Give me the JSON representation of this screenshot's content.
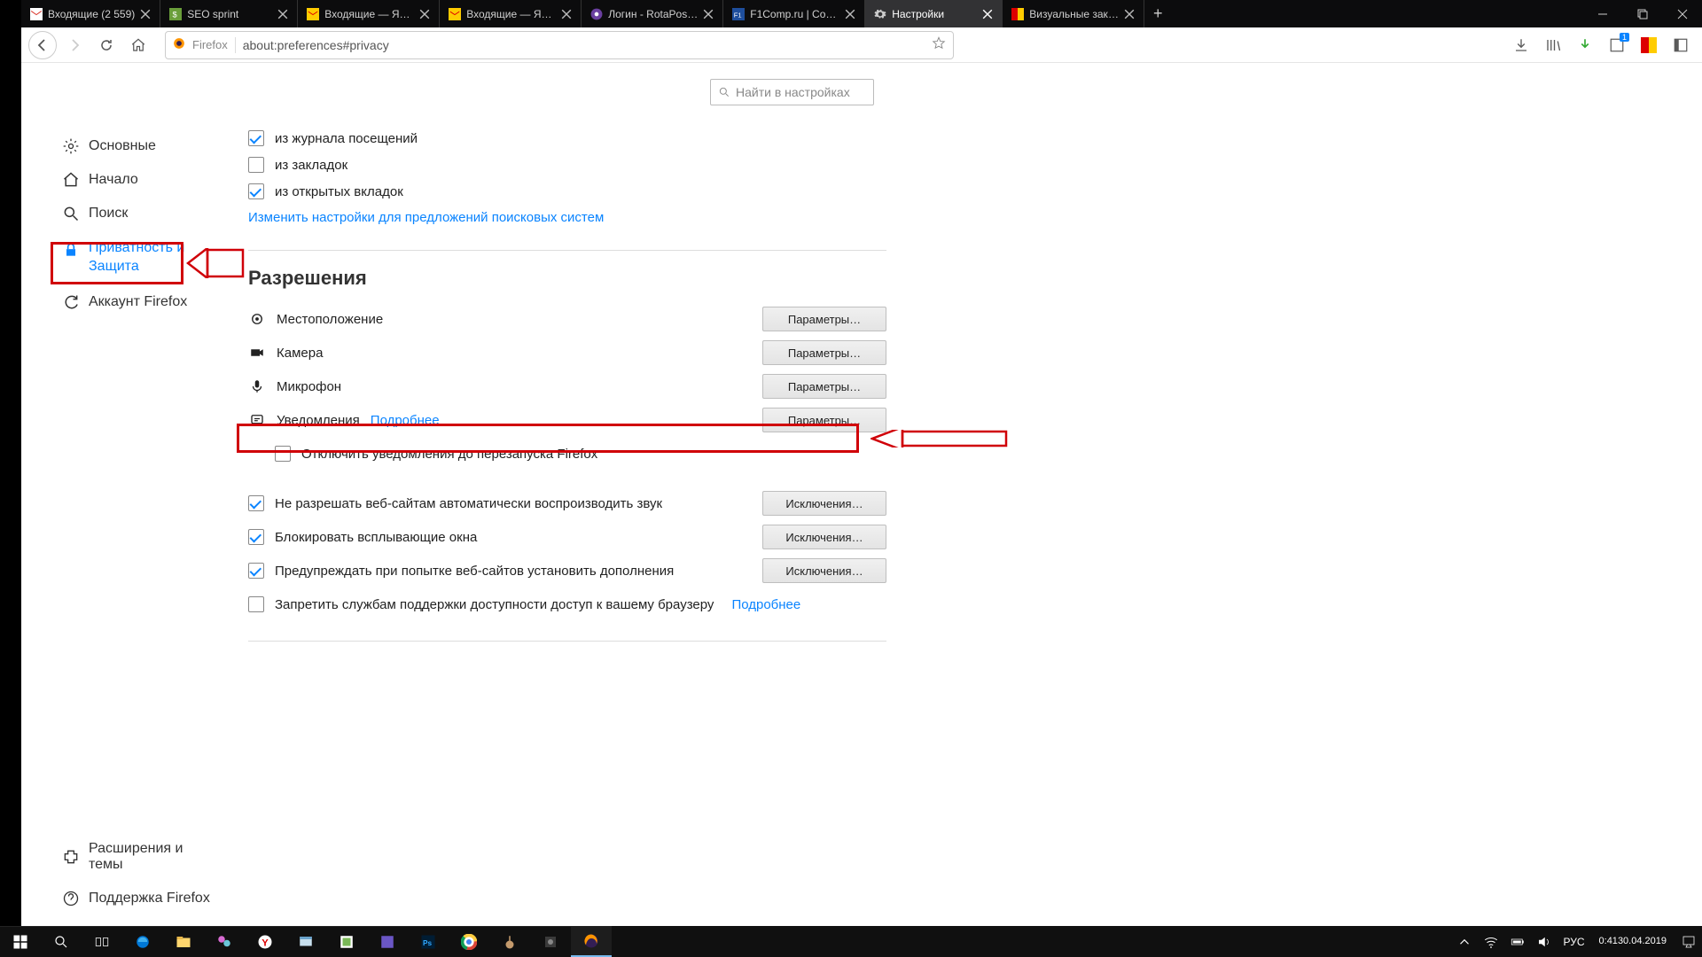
{
  "tabs": [
    {
      "title": "Входящие (2 559)",
      "type": "gmail"
    },
    {
      "title": "SEO sprint",
      "type": "seo"
    },
    {
      "title": "Входящие — Яндек",
      "type": "yandex"
    },
    {
      "title": "Входящие — Яндек",
      "type": "yandex"
    },
    {
      "title": "Логин - RotaPost.ru",
      "type": "rota"
    },
    {
      "title": "F1Comp.ru | Советы",
      "type": "f1"
    },
    {
      "title": "Настройки",
      "type": "settings",
      "active": true
    },
    {
      "title": "Визуальные заклад",
      "type": "vis"
    }
  ],
  "urlbar": {
    "brand": "Firefox",
    "url": "about:preferences#privacy"
  },
  "search": {
    "placeholder": "Найти в настройках"
  },
  "sidebar": {
    "general": "Основные",
    "home": "Начало",
    "search": "Поиск",
    "privacy": "Приватность и Защита",
    "sync": "Аккаунт Firefox",
    "ext": "Расширения и темы",
    "support": "Поддержка Firefox"
  },
  "main": {
    "chk_history": "из журнала посещений",
    "chk_bookmarks": "из закладок",
    "chk_opentabs": "из открытых вкладок",
    "search_engines_link": "Изменить настройки для предложений поисковых систем",
    "permissions_heading": "Разрешения",
    "location": "Местоположение",
    "camera": "Камера",
    "microphone": "Микрофон",
    "notifications": "Уведомления",
    "notifications_more": "Подробнее",
    "notifications_disable": "Отключить уведомления до перезапуска Firefox",
    "autoplay": "Не разрешать веб-сайтам автоматически воспроизводить звук",
    "popups": "Блокировать всплывающие окна",
    "addons": "Предупреждать при попытке веб-сайтов установить дополнения",
    "a11y": "Запретить службам поддержки доступности доступ к вашему браузеру",
    "a11y_more": "Подробнее",
    "btn_params": "Параметры…",
    "btn_exceptions": "Исключения…"
  },
  "tray": {
    "lang": "РУС",
    "time": "0:41",
    "date": "30.04.2019"
  }
}
